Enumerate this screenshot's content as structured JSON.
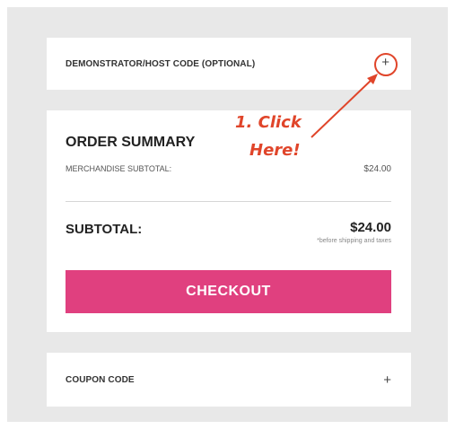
{
  "code_panel": {
    "label": "DEMONSTRATOR/HOST CODE (OPTIONAL)",
    "expand_icon": "+"
  },
  "order_summary": {
    "title": "ORDER SUMMARY",
    "merchandise_label": "MERCHANDISE SUBTOTAL:",
    "merchandise_value": "$24.00",
    "subtotal_label": "SUBTOTAL:",
    "subtotal_value": "$24.00",
    "subtotal_note": "*before shipping and taxes",
    "checkout_label": "CHECKOUT"
  },
  "coupon_panel": {
    "label": "COUPON CODE",
    "expand_icon": "+"
  },
  "annotation": {
    "line1": "1. Click",
    "line2": "Here!"
  },
  "colors": {
    "accent": "#e0407f",
    "annotation": "#e0452a",
    "background": "#e8e8e8"
  }
}
